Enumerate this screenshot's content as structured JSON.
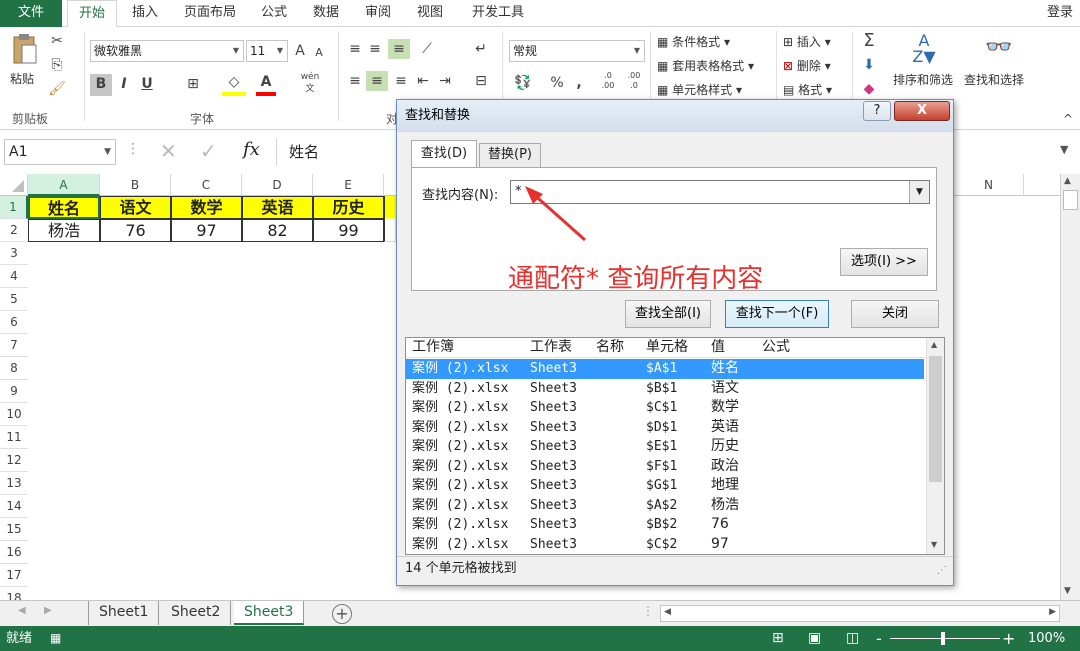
{
  "menu": {
    "file": "文件",
    "tabs": [
      "开始",
      "插入",
      "页面布局",
      "公式",
      "数据",
      "审阅",
      "视图",
      "开发工具"
    ],
    "login": "登录"
  },
  "ribbon": {
    "clipboard": {
      "paste": "粘贴",
      "group": "剪贴板"
    },
    "font": {
      "name": "微软雅黑",
      "size": "11",
      "group": "字体",
      "bold": "B",
      "italic": "I",
      "underline": "U",
      "grow": "A",
      "shrink": "A",
      "color_letter": "A",
      "phonetic": "wén"
    },
    "align": {
      "group": "对"
    },
    "number": {
      "format": "常规",
      "percent": "%",
      "comma": ",",
      "inc": ".0 .00",
      "dec": ".00 .0"
    },
    "styles": {
      "conditional": "条件格式",
      "table": "套用表格格式",
      "cell": "单元格样式"
    },
    "cells": {
      "insert": "插入",
      "delete": "删除",
      "format": "格式"
    },
    "editing": {
      "sum": "Σ",
      "sort": "排序和筛选",
      "find": "查找和选择"
    }
  },
  "formula_bar": {
    "name_box": "A1",
    "fx": "fx",
    "content": "姓名"
  },
  "grid": {
    "columns": [
      "A",
      "B",
      "C",
      "D",
      "E",
      "N"
    ],
    "rows": [
      "1",
      "2",
      "3",
      "4",
      "5",
      "6",
      "7",
      "8",
      "9",
      "10",
      "11",
      "12",
      "13",
      "14",
      "15",
      "16",
      "17",
      "18"
    ],
    "header": [
      "姓名",
      "语文",
      "数学",
      "英语",
      "历史"
    ],
    "data": [
      "杨浩",
      "76",
      "97",
      "82",
      "99"
    ]
  },
  "sheets": {
    "tabs": [
      "Sheet1",
      "Sheet2",
      "Sheet3"
    ],
    "active": "Sheet3",
    "add": "+"
  },
  "status": {
    "ready": "就绪",
    "zoom": "100%",
    "minus": "-",
    "plus": "+"
  },
  "dialog": {
    "title": "查找和替换",
    "help": "?",
    "close": "X",
    "tabs": [
      "查找(D)",
      "替换(P)"
    ],
    "find_label": "查找内容(N):",
    "find_value": "*",
    "annotation": "通配符* 查询所有内容",
    "options_btn": "选项(I) >>",
    "find_all_btn": "查找全部(I)",
    "find_next_btn": "查找下一个(F)",
    "close_btn": "关闭",
    "columns": [
      "工作簿",
      "工作表",
      "名称",
      "单元格",
      "值",
      "公式"
    ],
    "results": [
      {
        "book": "案例 (2).xlsx",
        "sheet": "Sheet3",
        "cell": "$A$1",
        "value": "姓名"
      },
      {
        "book": "案例 (2).xlsx",
        "sheet": "Sheet3",
        "cell": "$B$1",
        "value": "语文"
      },
      {
        "book": "案例 (2).xlsx",
        "sheet": "Sheet3",
        "cell": "$C$1",
        "value": "数学"
      },
      {
        "book": "案例 (2).xlsx",
        "sheet": "Sheet3",
        "cell": "$D$1",
        "value": "英语"
      },
      {
        "book": "案例 (2).xlsx",
        "sheet": "Sheet3",
        "cell": "$E$1",
        "value": "历史"
      },
      {
        "book": "案例 (2).xlsx",
        "sheet": "Sheet3",
        "cell": "$F$1",
        "value": "政治"
      },
      {
        "book": "案例 (2).xlsx",
        "sheet": "Sheet3",
        "cell": "$G$1",
        "value": "地理"
      },
      {
        "book": "案例 (2).xlsx",
        "sheet": "Sheet3",
        "cell": "$A$2",
        "value": "杨浩"
      },
      {
        "book": "案例 (2).xlsx",
        "sheet": "Sheet3",
        "cell": "$B$2",
        "value": "76"
      },
      {
        "book": "案例 (2).xlsx",
        "sheet": "Sheet3",
        "cell": "$C$2",
        "value": "97"
      }
    ],
    "status": "14 个单元格被找到"
  },
  "colors": {
    "excel_green": "#217346",
    "header_fill": "#ffff00",
    "annotation": "#e8312f",
    "selection": "#3399ff"
  }
}
